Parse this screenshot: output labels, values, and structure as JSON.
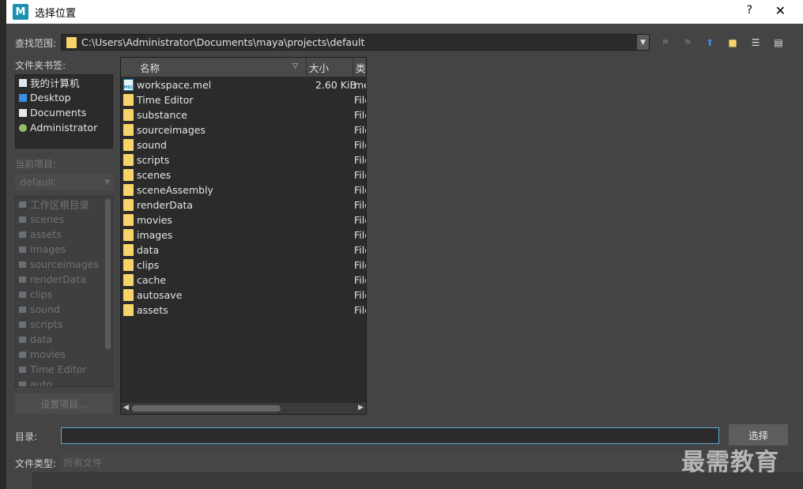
{
  "window": {
    "title": "选择位置",
    "app_icon": "M",
    "help": "?",
    "close": "✕"
  },
  "look_in": {
    "label": "查找范围:",
    "path": "C:\\Users\\Administrator\\Documents\\maya\\projects\\default"
  },
  "bookmarks": {
    "label": "文件夹书签:",
    "items": [
      {
        "label": "我的计算机",
        "icon": "computer-icon"
      },
      {
        "label": "Desktop",
        "icon": "desktop-icon"
      },
      {
        "label": "Documents",
        "icon": "documents-icon"
      },
      {
        "label": "Administrator",
        "icon": "user-icon"
      }
    ]
  },
  "project": {
    "label": "当前项目:",
    "selected": "default",
    "items": [
      "工作区根目录",
      "scenes",
      "assets",
      "images",
      "sourceimages",
      "renderData",
      "clips",
      "sound",
      "scripts",
      "data",
      "movies",
      "Time Editor",
      "auto"
    ],
    "set_button": "设置项目..."
  },
  "files": {
    "columns": {
      "name": "名称",
      "size": "大小",
      "type": "类"
    },
    "rows": [
      {
        "name": "workspace.mel",
        "size": "2.60 KiB",
        "type": "me",
        "kind": "mel"
      },
      {
        "name": "Time Editor",
        "size": "",
        "type": "File",
        "kind": "folder"
      },
      {
        "name": "substance",
        "size": "",
        "type": "File",
        "kind": "folder"
      },
      {
        "name": "sourceimages",
        "size": "",
        "type": "File",
        "kind": "folder"
      },
      {
        "name": "sound",
        "size": "",
        "type": "File",
        "kind": "folder"
      },
      {
        "name": "scripts",
        "size": "",
        "type": "File",
        "kind": "folder"
      },
      {
        "name": "scenes",
        "size": "",
        "type": "File",
        "kind": "folder"
      },
      {
        "name": "sceneAssembly",
        "size": "",
        "type": "File",
        "kind": "folder"
      },
      {
        "name": "renderData",
        "size": "",
        "type": "File",
        "kind": "folder"
      },
      {
        "name": "movies",
        "size": "",
        "type": "File",
        "kind": "folder"
      },
      {
        "name": "images",
        "size": "",
        "type": "File",
        "kind": "folder"
      },
      {
        "name": "data",
        "size": "",
        "type": "File",
        "kind": "folder"
      },
      {
        "name": "clips",
        "size": "",
        "type": "File",
        "kind": "folder"
      },
      {
        "name": "cache",
        "size": "",
        "type": "File",
        "kind": "folder"
      },
      {
        "name": "autosave",
        "size": "",
        "type": "File",
        "kind": "folder"
      },
      {
        "name": "assets",
        "size": "",
        "type": "File",
        "kind": "folder"
      }
    ]
  },
  "directory": {
    "label": "目录:",
    "value": ""
  },
  "select_button": "选择",
  "file_type": {
    "label": "文件类型:",
    "value": "所有文件"
  },
  "watermark": "最需教育"
}
